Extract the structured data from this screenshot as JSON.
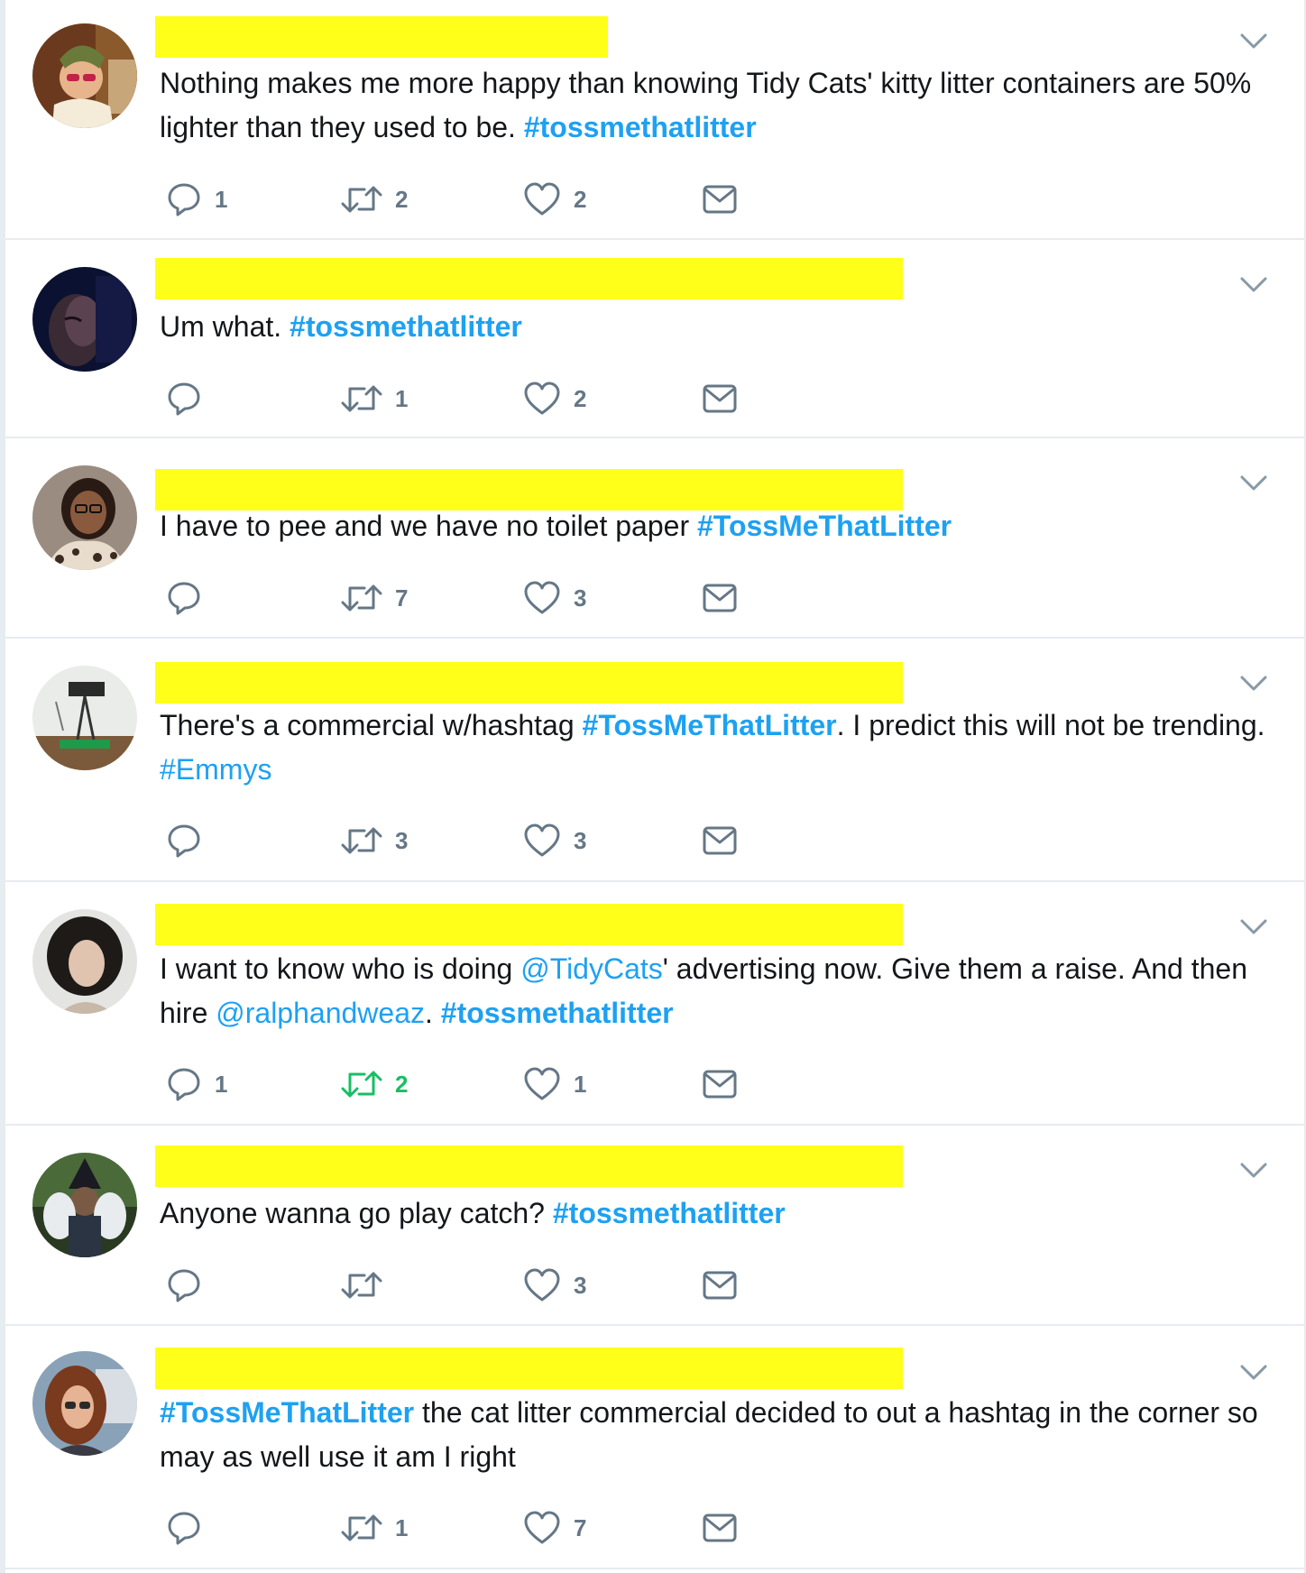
{
  "colors": {
    "link": "#1da1f2",
    "redaction": "#ffff1a",
    "icon": "#657786",
    "retweeted": "#17bf63",
    "divider": "#e6ecf0"
  },
  "tweets": [
    {
      "segments": [
        {
          "text": "Nothing makes me more happy than knowing Tidy Cats' kitty litter containers are 50% lighter than they used to be. ",
          "style": "plain"
        },
        {
          "text": "#tossmethatlitter",
          "style": "hashtag-bold"
        }
      ],
      "reply_count": "1",
      "retweet_count": "2",
      "like_count": "2",
      "retweeted": false
    },
    {
      "segments": [
        {
          "text": "Um what. ",
          "style": "plain"
        },
        {
          "text": "#tossmethatlitter",
          "style": "hashtag-bold"
        }
      ],
      "reply_count": "",
      "retweet_count": "1",
      "like_count": "2",
      "retweeted": false
    },
    {
      "segments": [
        {
          "text": "I have to pee and we have no toilet paper ",
          "style": "plain"
        },
        {
          "text": "#TossMeThatLitter",
          "style": "hashtag-bold"
        }
      ],
      "reply_count": "",
      "retweet_count": "7",
      "like_count": "3",
      "retweeted": false
    },
    {
      "segments": [
        {
          "text": "There's a commercial w/hashtag ",
          "style": "plain"
        },
        {
          "text": "#TossMeThatLitter",
          "style": "hashtag-bold"
        },
        {
          "text": ". I predict this will not be trending. ",
          "style": "plain"
        },
        {
          "text": "#Emmys",
          "style": "hashtag"
        }
      ],
      "reply_count": "",
      "retweet_count": "3",
      "like_count": "3",
      "retweeted": false
    },
    {
      "segments": [
        {
          "text": "I want to know who is doing ",
          "style": "plain"
        },
        {
          "text": "@TidyCats",
          "style": "mention"
        },
        {
          "text": "' advertising now. Give them a raise. And then hire ",
          "style": "plain"
        },
        {
          "text": "@ralphandweaz",
          "style": "mention"
        },
        {
          "text": ". ",
          "style": "plain"
        },
        {
          "text": "#tossmethatlitter",
          "style": "hashtag-bold"
        }
      ],
      "reply_count": "1",
      "retweet_count": "2",
      "like_count": "1",
      "retweeted": true
    },
    {
      "segments": [
        {
          "text": "Anyone wanna go play catch? ",
          "style": "plain"
        },
        {
          "text": "#tossmethatlitter",
          "style": "hashtag-bold"
        }
      ],
      "reply_count": "",
      "retweet_count": "",
      "like_count": "3",
      "retweeted": false
    },
    {
      "segments": [
        {
          "text": "#TossMeThatLitter",
          "style": "hashtag-bold"
        },
        {
          "text": " the cat litter commercial decided to out a hashtag in the corner so may as well use it am I right",
          "style": "plain"
        }
      ],
      "reply_count": "",
      "retweet_count": "1",
      "like_count": "7",
      "retweeted": false
    }
  ]
}
